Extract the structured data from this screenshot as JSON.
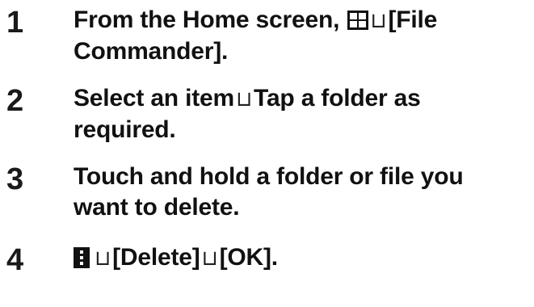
{
  "steps": [
    {
      "number": "1",
      "line1_prefix": "From the Home screen, ",
      "line1_icon": "apps-grid-icon",
      "separator": "⊔",
      "line1_suffix": "[File",
      "line2": "Commander]."
    },
    {
      "number": "2",
      "line1_prefix": "Select an item",
      "separator": "⊔",
      "line1_suffix": "Tap a folder as",
      "line2": "required."
    },
    {
      "number": "3",
      "line1": "Touch and hold a folder or file you",
      "line2": "want to delete."
    },
    {
      "number": "4",
      "line1_icon": "menu-icon",
      "separator": "⊔",
      "part_a": "[Delete]",
      "part_b": "[OK]."
    }
  ]
}
